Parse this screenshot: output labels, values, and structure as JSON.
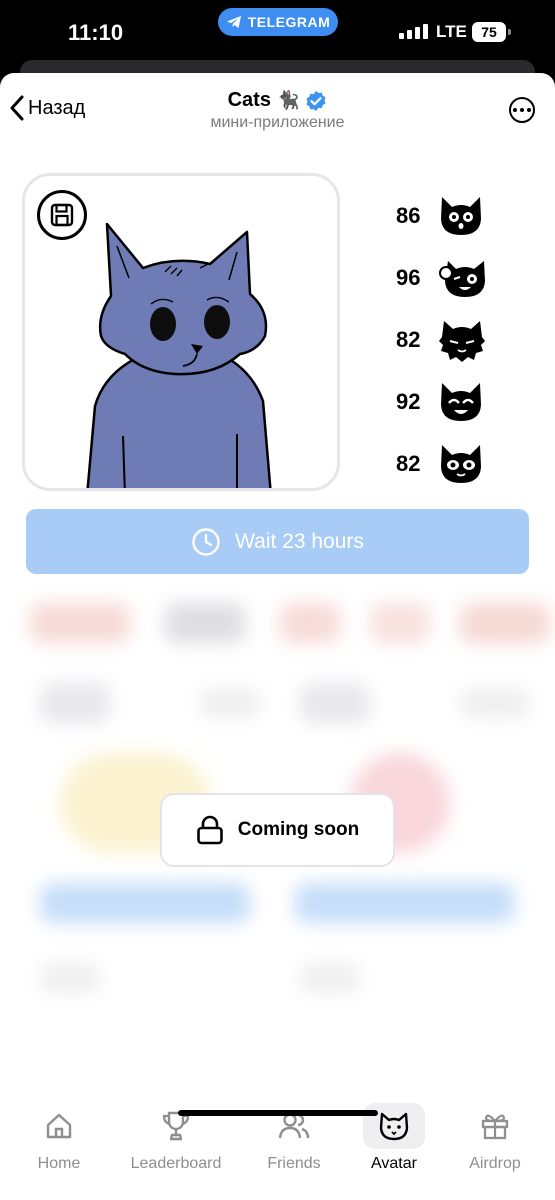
{
  "status_bar": {
    "time": "11:10",
    "app_pill": "TELEGRAM",
    "network": "LTE",
    "battery": "75"
  },
  "nav": {
    "back_label": "Назад",
    "title": "Cats",
    "title_emoji": "🐈‍⬛",
    "subtitle": "мини-приложение",
    "more_icon": "ellipsis-circle-icon"
  },
  "avatar": {
    "save_icon": "floppy-disk-icon",
    "body_color": "#6f7bb5"
  },
  "stats": [
    {
      "value": "86",
      "icon": "cat-face-surprised-icon"
    },
    {
      "value": "96",
      "icon": "cat-face-wink-icon"
    },
    {
      "value": "82",
      "icon": "cat-face-fluffy-icon"
    },
    {
      "value": "92",
      "icon": "cat-face-happy-icon"
    },
    {
      "value": "82",
      "icon": "cat-face-sparkle-icon"
    }
  ],
  "wait_button": {
    "label": "Wait 23 hours",
    "icon": "clock-icon",
    "color": "#a9ccf6"
  },
  "coming_soon": {
    "label": "Coming soon",
    "icon": "lock-icon"
  },
  "tabs": [
    {
      "label": "Home",
      "icon": "home-icon",
      "active": false
    },
    {
      "label": "Leaderboard",
      "icon": "trophy-icon",
      "active": false
    },
    {
      "label": "Friends",
      "icon": "friends-icon",
      "active": false
    },
    {
      "label": "Avatar",
      "icon": "cat-icon",
      "active": true
    },
    {
      "label": "Airdrop",
      "icon": "gift-icon",
      "active": false
    }
  ]
}
